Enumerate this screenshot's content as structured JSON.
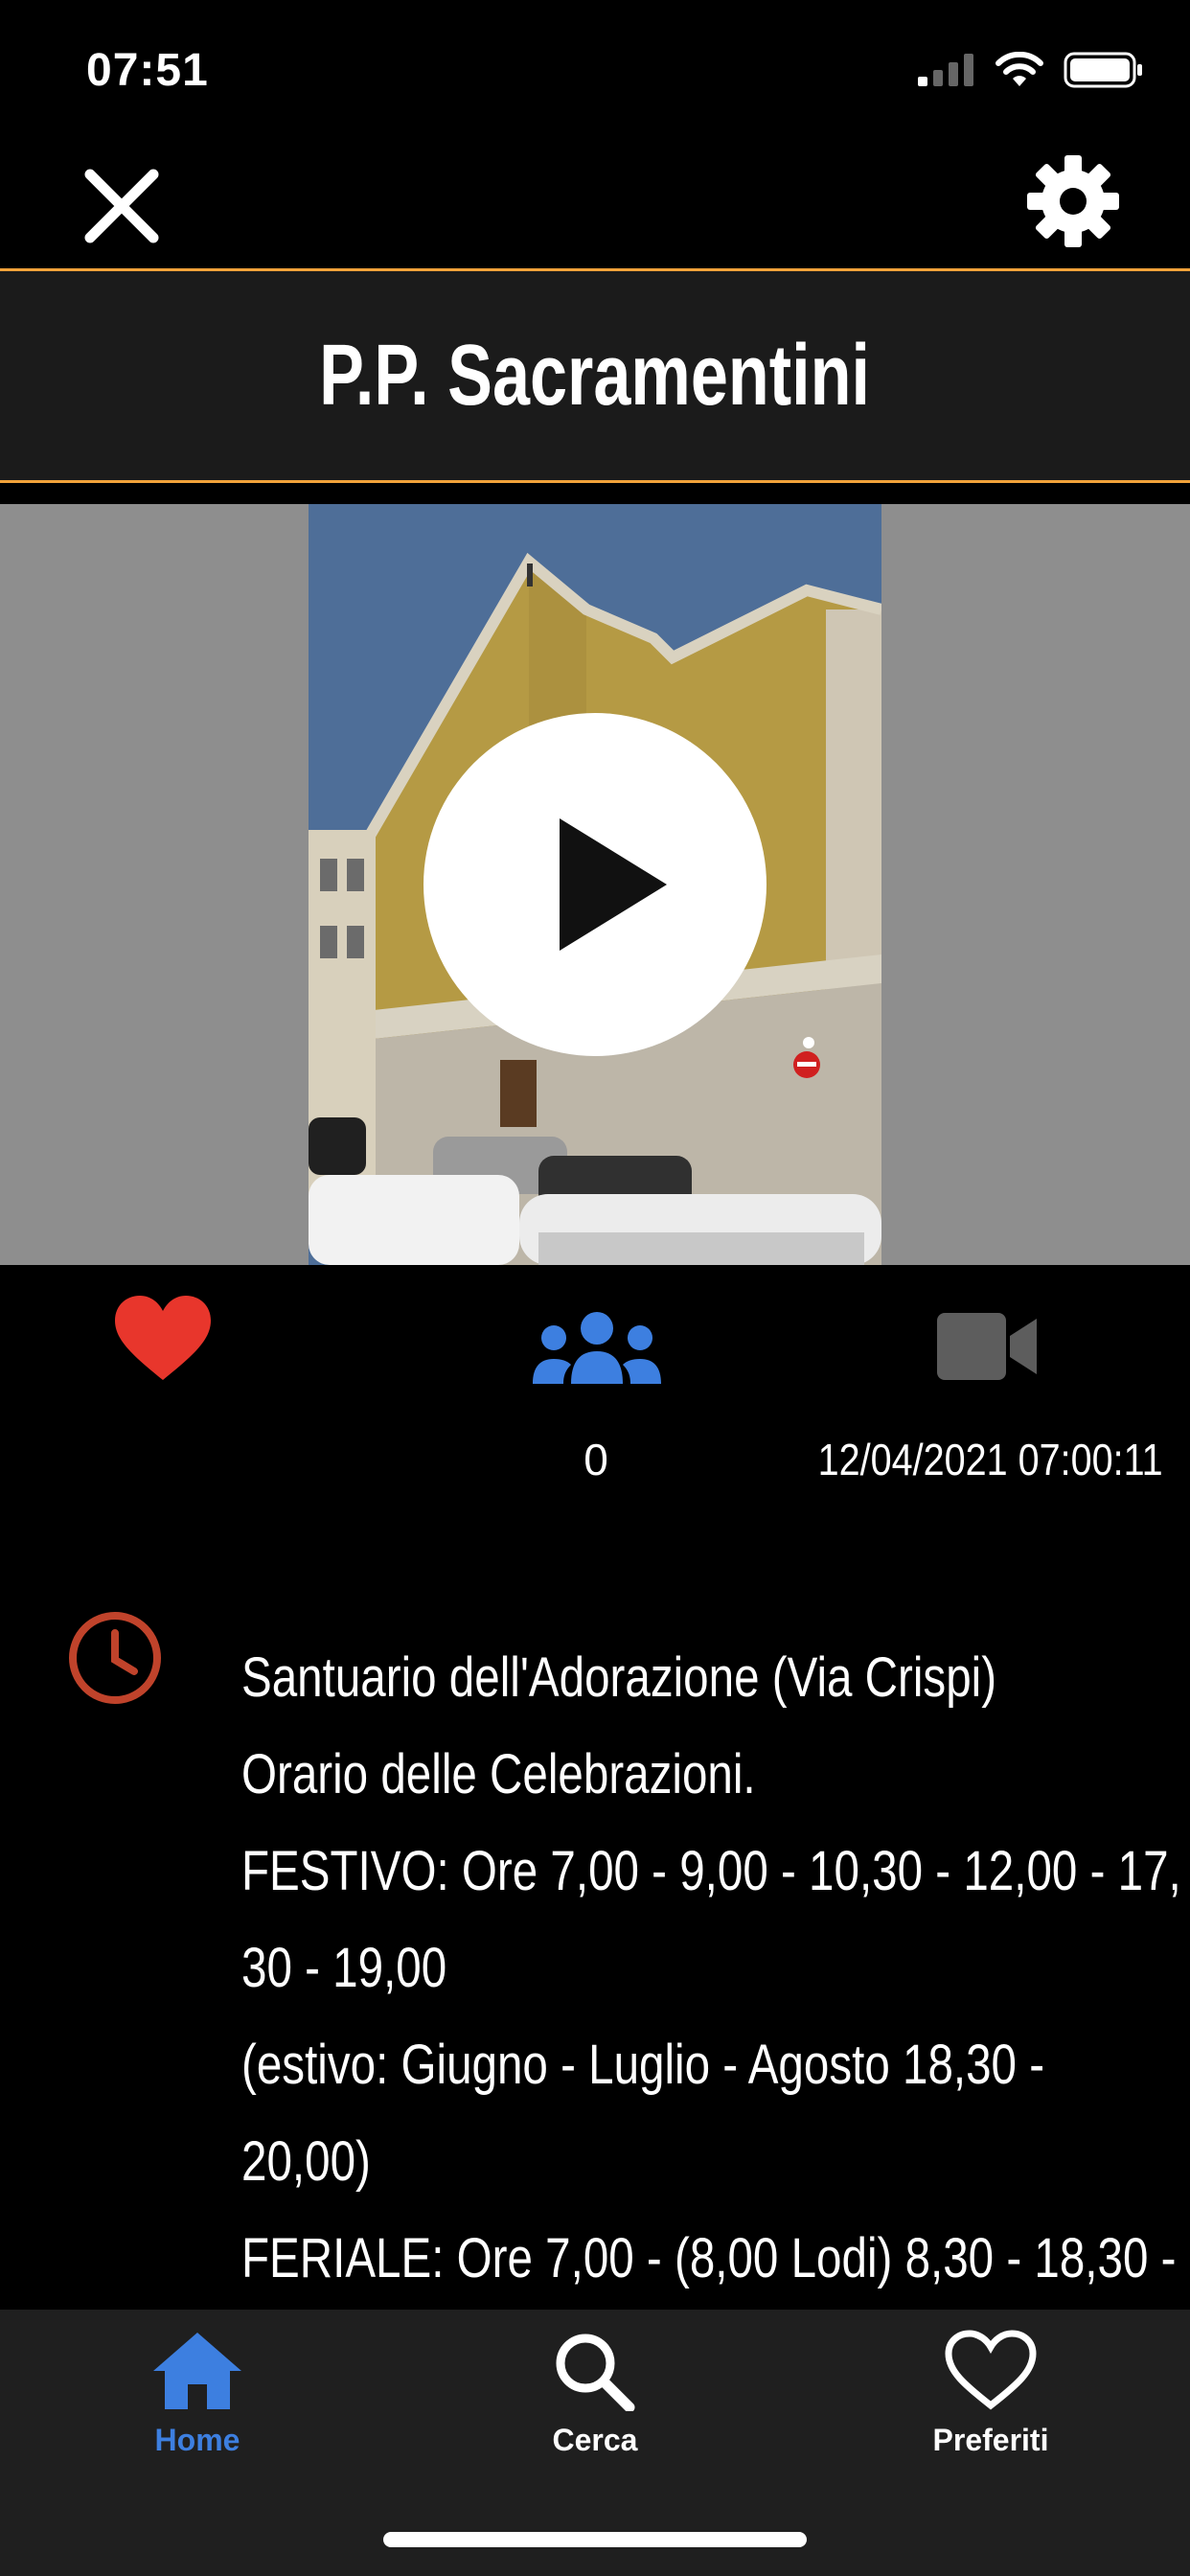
{
  "status_bar": {
    "time": "07:51"
  },
  "header": {
    "close_icon": "close-icon",
    "settings_icon": "gear-icon",
    "title": "P.P. Sacramentini"
  },
  "video": {
    "thumbnail": "church facade photo",
    "play_icon": "play-icon"
  },
  "actions": {
    "favorite_icon": "heart-icon",
    "favorite_color": "#e8362c",
    "viewers_icon": "people-icon",
    "viewers_color": "#3d7fe0",
    "video_icon": "video-camera-icon",
    "viewers_count": "0",
    "timestamp": "12/04/2021 07:00:11"
  },
  "description": {
    "icon": "clock-icon",
    "icon_color": "#c0432b",
    "lines": [
      "Santuario dell'Adorazione (Via Crispi)",
      "Orario delle Celebrazioni.",
      "FESTIVO: Ore 7,00 - 9,00 - 10,30 - 12,00 - 17,",
      "30 - 19,00",
      "(estivo: Giugno - Luglio - Agosto 18,30 -",
      "20,00)",
      "FERIALE: Ore 7,00 - (8,00 Lodi) 8,30 - 18,30 -"
    ]
  },
  "tabbar": {
    "items": [
      {
        "label": "Home",
        "icon": "home-icon",
        "active": true
      },
      {
        "label": "Cerca",
        "icon": "search-icon",
        "active": false
      },
      {
        "label": "Preferiti",
        "icon": "heart-outline-icon",
        "active": false
      }
    ],
    "active_color": "#3d7fe0"
  }
}
